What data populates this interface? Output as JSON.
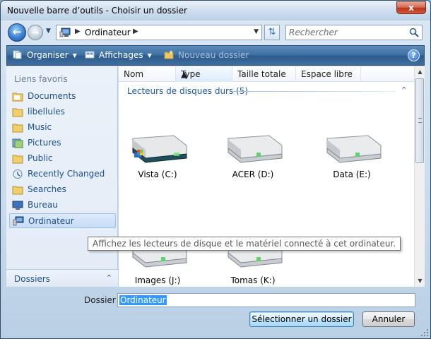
{
  "window": {
    "title": "Nouvelle barre d’outils - Choisir un dossier",
    "close_symbol": "x"
  },
  "address": {
    "location": "Ordinateur",
    "search_placeholder": "Rechercher"
  },
  "toolbar": {
    "organize_label": "Organiser",
    "views_label": "Affichages",
    "new_folder_label": "Nouveau dossier",
    "help_symbol": "?"
  },
  "sidebar": {
    "favorites_header": "Liens favoris",
    "items": [
      {
        "label": "Documents",
        "icon": "folder-icon"
      },
      {
        "label": "libellules",
        "icon": "folder-icon"
      },
      {
        "label": "Music",
        "icon": "folder-icon"
      },
      {
        "label": "Pictures",
        "icon": "pictures-icon"
      },
      {
        "label": "Public",
        "icon": "folder-icon"
      },
      {
        "label": "Recently Changed",
        "icon": "recent-icon"
      },
      {
        "label": "Searches",
        "icon": "folder-icon"
      },
      {
        "label": "Bureau",
        "icon": "desktop-icon"
      },
      {
        "label": "Ordinateur",
        "icon": "computer-icon",
        "selected": true
      }
    ],
    "folders_label": "Dossiers"
  },
  "columns": [
    "Nom",
    "Type",
    "Taille totale",
    "Espace libre"
  ],
  "group": {
    "title": "Lecteurs de disques durs (5)"
  },
  "drives": [
    {
      "label": "Vista (C:)",
      "system": true
    },
    {
      "label": "ACER (D:)",
      "system": false
    },
    {
      "label": "Data (E:)",
      "system": false
    },
    {
      "label": "Images (J:)",
      "system": false
    },
    {
      "label": "Tomas (K:)",
      "system": false
    }
  ],
  "tooltip": "Affichez les lecteurs de disque et le matériel connecté à cet ordinateur.",
  "footer": {
    "folder_label": "Dossier :",
    "folder_value": "Ordinateur",
    "select_button": "Sélectionner un dossier",
    "cancel_button": "Annuler"
  },
  "colors": {
    "accent": "#1c5aa6",
    "toolbar": "#3d6fa3",
    "selection": "#3399ff"
  }
}
